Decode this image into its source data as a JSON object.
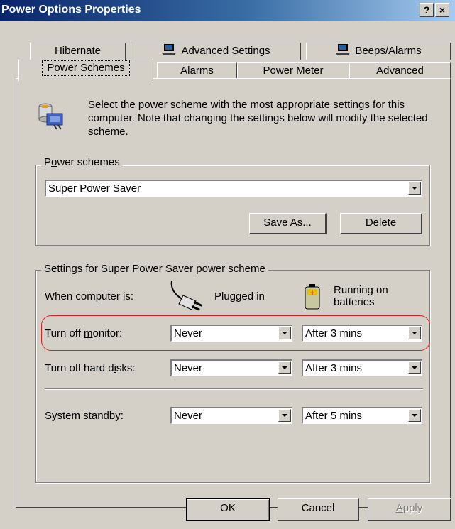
{
  "window": {
    "title": "Power Options Properties",
    "help_glyph": "?",
    "close_glyph": "×"
  },
  "tabs_row1": [
    {
      "label": "Hibernate",
      "icon": ""
    },
    {
      "label": "Advanced Settings",
      "icon": "laptop-icon"
    },
    {
      "label": "Beeps/Alarms",
      "icon": "laptop-icon"
    }
  ],
  "tabs_row2": [
    {
      "label": "Power Schemes",
      "selected": true
    },
    {
      "label": "Alarms",
      "selected": false
    },
    {
      "label": "Power Meter",
      "selected": false
    },
    {
      "label": "Advanced",
      "selected": false
    }
  ],
  "description": "Select the power scheme with the most appropriate settings for this computer. Note that changing the settings below will modify the selected scheme.",
  "power_schemes": {
    "group_label_pre": "P",
    "group_label_ul": "o",
    "group_label_post": "wer schemes",
    "selected": "Super Power Saver",
    "save_as_ul": "S",
    "save_as_rest": "ave As...",
    "delete_ul": "D",
    "delete_rest": "elete"
  },
  "settings": {
    "group_label": "Settings for Super Power Saver power scheme",
    "when_label": "When computer is:",
    "plugged_in": "Plugged in",
    "running_on_1": "Running on",
    "running_on_2": "batteries",
    "rows": [
      {
        "label_pre": "Turn off ",
        "label_ul": "m",
        "label_post": "onitor:",
        "plugged": "Never",
        "battery": "After 3 mins"
      },
      {
        "label_pre": "Turn off hard d",
        "label_ul": "i",
        "label_post": "sks:",
        "plugged": "Never",
        "battery": "After 3 mins"
      },
      {
        "label_pre": "System st",
        "label_ul": "a",
        "label_post": "ndby:",
        "plugged": "Never",
        "battery": "After 5 mins"
      }
    ]
  },
  "buttons": {
    "ok": "OK",
    "cancel": "Cancel",
    "apply_ul": "A",
    "apply_rest": "pply"
  },
  "colors": {
    "highlight": "#e02020",
    "title_start": "#0a246a",
    "title_end": "#a6caf0"
  }
}
